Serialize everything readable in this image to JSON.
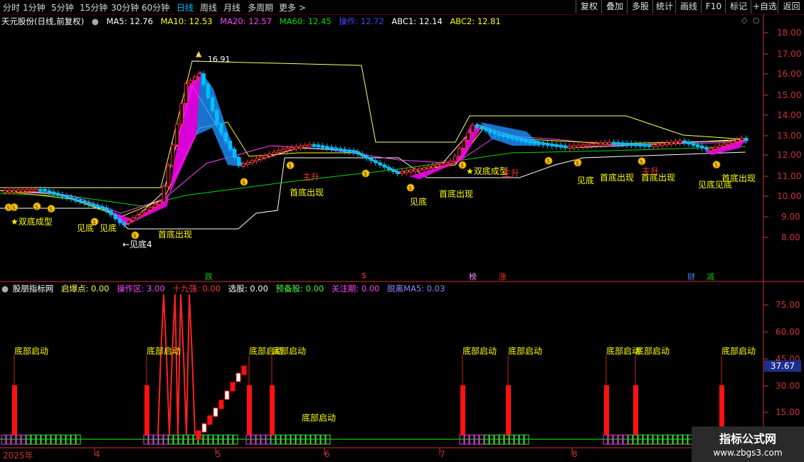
{
  "toolbar": {
    "periods": [
      "分时",
      "1分钟",
      "5分钟",
      "15分钟",
      "30分钟",
      "60分钟",
      "日线",
      "周线",
      "月线",
      "多周期",
      "更多 >"
    ],
    "active_period": "日线",
    "right_buttons": [
      "复权",
      "叠加",
      "多股",
      "统计",
      "画线",
      "F10",
      "标记",
      "+自选",
      "返回"
    ]
  },
  "main_legend": {
    "title": "天元股份(日线,前复权)",
    "items": [
      {
        "text": "MA5: 12.76",
        "color": "#ffffff"
      },
      {
        "text": "MA10: 12.53",
        "color": "#ffff00"
      },
      {
        "text": "MA20: 12.57",
        "color": "#ff44ff"
      },
      {
        "text": "MA60: 12.45",
        "color": "#00dd00"
      },
      {
        "text": "操作: 12.72",
        "color": "#4444ff"
      },
      {
        "text": "ABC1: 12.14",
        "color": "#ffffff"
      },
      {
        "text": "ABC2: 12.81",
        "color": "#ffff00"
      }
    ]
  },
  "main_axis": [
    "18.00",
    "17.00",
    "16.00",
    "15.00",
    "14.00",
    "13.00",
    "12.00",
    "11.00",
    "10.00",
    "9.00",
    "8.00"
  ],
  "sub_legend": {
    "title": "股朋指标网",
    "items": [
      {
        "text": "启爆点: 0.00",
        "color": "#ffff44"
      },
      {
        "text": "操作区: 3.00",
        "color": "#ff44ff"
      },
      {
        "text": "十九强: 0.00",
        "color": "#ff3333"
      },
      {
        "text": "选股: 0.00",
        "color": "#ffffff"
      },
      {
        "text": "预备股: 0.00",
        "color": "#44ff44"
      },
      {
        "text": "关注期: 0.00",
        "color": "#ff44ff"
      },
      {
        "text": "脱离MA5: 0.03",
        "color": "#8888ff"
      }
    ]
  },
  "sub_axis": [
    "75.00",
    "60.00",
    "45.00",
    "30.00",
    "15.00"
  ],
  "sub_axis_current": "37.67",
  "date_axis": [
    "2025年",
    "4",
    "5",
    "6",
    "7",
    "8"
  ],
  "price_peak_label": "16.91",
  "annotations_main": [
    "★双底成型",
    "见底",
    "见底",
    "←见底4",
    "首底出现",
    "首底出现",
    "主升",
    "见底",
    "首底出现",
    "★双底成型",
    "主升",
    "见底",
    "首底出现",
    "主升",
    "首底出现",
    "见底见底",
    "首底出现"
  ],
  "event_markers": [
    {
      "text": "跌",
      "color": "#00cc00"
    },
    {
      "text": "$",
      "color": "#ff3333"
    },
    {
      "text": "榜",
      "color": "#ff88ff"
    },
    {
      "text": "涨",
      "color": "#ff3333"
    },
    {
      "text": "财",
      "color": "#4488ff"
    },
    {
      "text": "减",
      "color": "#00cc00"
    }
  ],
  "annotations_sub": [
    "底部启动",
    "底部启动",
    "底部启动",
    "底部启动",
    "底部启动",
    "底部启动",
    "底部启动",
    "底部启动",
    "底部启动",
    "底部启动"
  ],
  "watermark": {
    "title": "指标公式网",
    "url": "www.zbgs3.com"
  },
  "colors": {
    "up": "#ff3333",
    "down": "#00c0ff",
    "bg": "#000000",
    "axis": "#cc3333"
  }
}
